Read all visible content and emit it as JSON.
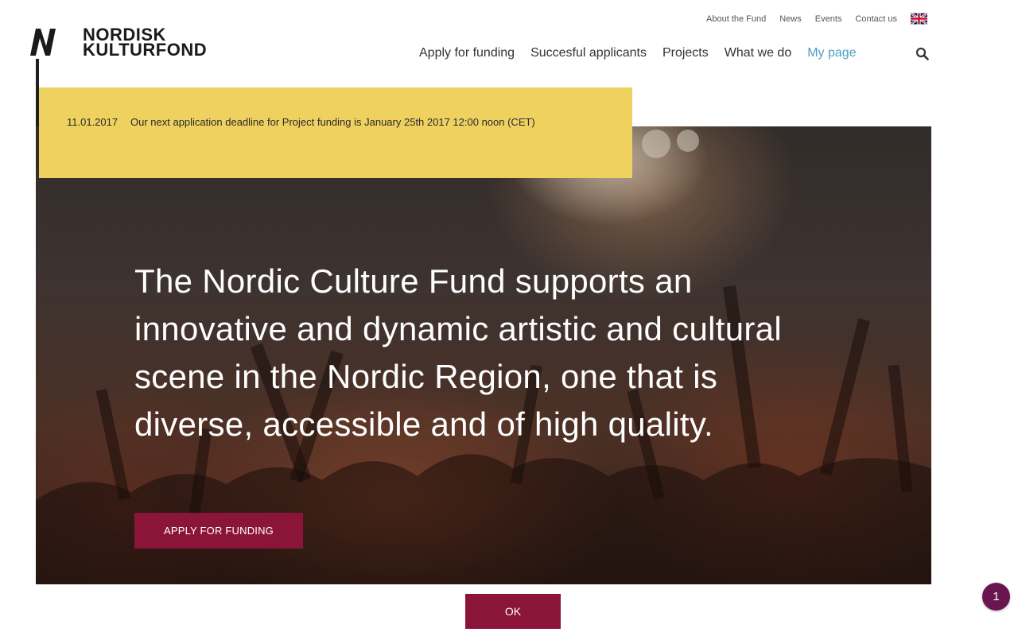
{
  "brand": {
    "logo_mark": "N",
    "name_line1": "NORDISK",
    "name_line2": "KULTURFOND"
  },
  "utility_nav": [
    "About the Fund",
    "News",
    "Events",
    "Contact us"
  ],
  "language_flag": "uk-flag-icon",
  "main_nav": [
    {
      "label": "Apply for funding",
      "active": false
    },
    {
      "label": "Succesful applicants",
      "active": false
    },
    {
      "label": "Projects",
      "active": false
    },
    {
      "label": "What we do",
      "active": false
    },
    {
      "label": "My page",
      "active": true
    }
  ],
  "search_icon": "search-icon",
  "notice": {
    "date": "11.01.2017",
    "text": "Our next application deadline for Project funding is January 25th 2017 12:00 noon (CET)"
  },
  "hero": {
    "headline": "The Nordic Culture Fund supports an innovative and dynamic artistic and cultural scene in the Nordic Region, one that is diverse, accessible and of high quality.",
    "cta_label": "APPLY FOR FUNDING"
  },
  "cookie": {
    "ok_label": "OK"
  },
  "badge": {
    "count": "1"
  },
  "colors": {
    "accent": "#8a1538",
    "notice_bg": "#efd160",
    "active_nav": "#4d9fc4",
    "badge_bg": "#6b1550"
  }
}
